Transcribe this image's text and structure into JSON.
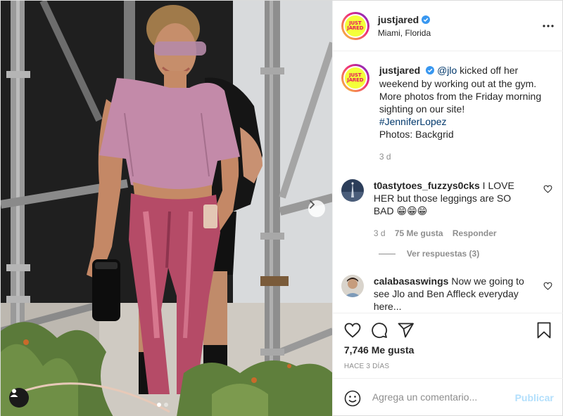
{
  "post": {
    "author": "justjared",
    "location": "Miami, Florida",
    "avatar_text": [
      "JUST",
      "JARED"
    ],
    "caption": {
      "mention": "@jlo",
      "text": " kicked off her weekend by working out at the gym. More photos from the Friday morning sighting on our site!",
      "hashtag": "#JenniferLopez",
      "credit": "Photos: Backgrid",
      "time": "3 d"
    },
    "comments": [
      {
        "user": "t0astytoes_fuzzys0cks",
        "text": " I LOVE HER but those leggings are SO BAD 😁😁😁",
        "time": "3 d",
        "likes": "75 Me gusta",
        "reply_label": "Responder"
      },
      {
        "user": "calabasaswings",
        "text": " Now we going to see Jlo and Ben Affleck everyday here..."
      }
    ],
    "view_replies": "Ver respuestas (3)",
    "likes_count": "7,746 Me gusta",
    "posted_ago": "HACE 3 DÍAS",
    "comment_placeholder": "Agrega un comentario...",
    "publish_label": "Publicar"
  },
  "icons": [
    "verified-badge-icon",
    "more-options-icon",
    "heart-icon",
    "comment-icon",
    "share-icon",
    "bookmark-icon",
    "emoji-icon",
    "chevron-right-icon",
    "user-tag-icon"
  ],
  "colors": {
    "link": "#00376b",
    "verified": "#3897f0",
    "publish_disabled": "#b2dffc",
    "muted": "#8e8e8e"
  }
}
